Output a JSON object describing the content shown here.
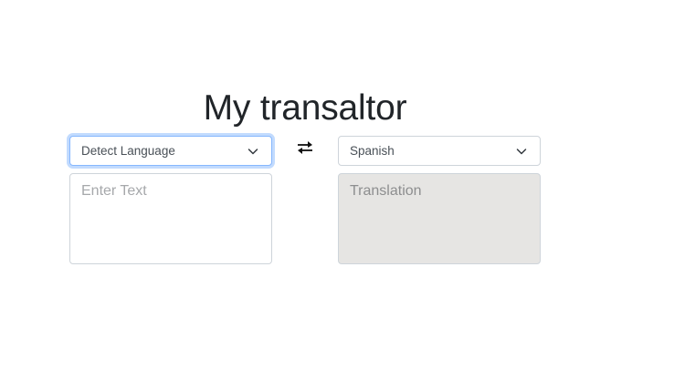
{
  "page": {
    "title": "My transaltor"
  },
  "source": {
    "language_selected": "Detect Language",
    "input_value": "",
    "input_placeholder": "Enter Text"
  },
  "target": {
    "language_selected": "Spanish",
    "output_value": "",
    "output_placeholder": "Translation"
  },
  "icons": {
    "swap": "swap-arrows-icon",
    "dropdown": "chevron-down-icon"
  },
  "colors": {
    "focus_border": "#86b7fe",
    "readonly_background": "#e6e5e3",
    "title_text": "#212529"
  }
}
